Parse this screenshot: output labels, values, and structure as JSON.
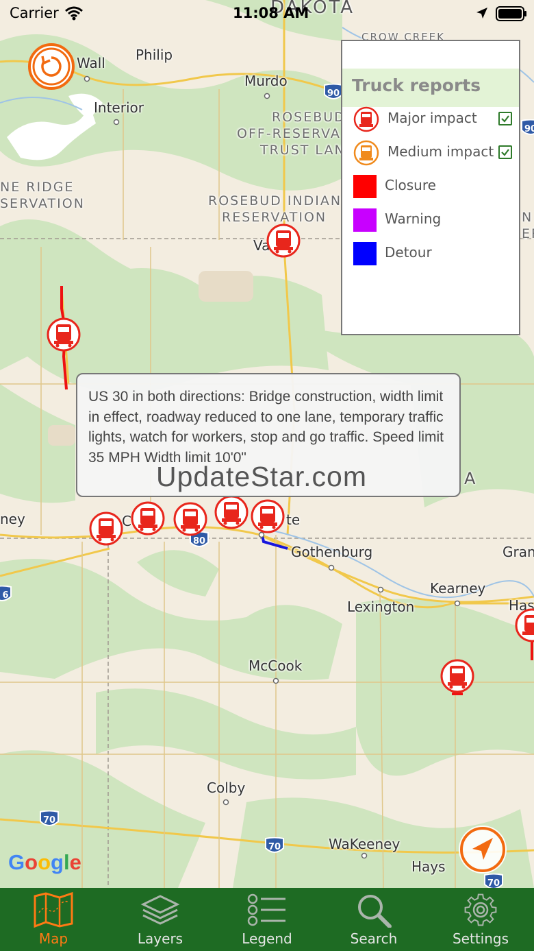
{
  "status_bar": {
    "carrier": "Carrier",
    "time": "11:08 AM"
  },
  "map": {
    "labels": {
      "dakota": "DAKOTA",
      "crow_creek": "CROW CREEK",
      "wall": "Wall",
      "philip": "Philip",
      "murdo": "Murdo",
      "interior": "Interior",
      "rosebud_off_1": "ROSEBUD",
      "rosebud_off_2": "OFF-RESERVA",
      "rosebud_off_3": "TRUST LAN",
      "pine_ridge_1": "NE RIDGE",
      "pine_ridge_2": "SERVATION",
      "rosebud_res_1": "ROSEBUD INDIAN",
      "rosebud_res_2": "RESERVATION",
      "valentine": "Va        ne",
      "ogallala_partial": "C",
      "north_platte_partial": "te",
      "kearney_left": "ney",
      "gothenburg": "Gothenburg",
      "kearney": "Kearney",
      "grand": "Gran",
      "lexington": "Lexington",
      "hastings": "Has",
      "mccook": "McCook",
      "colby": "Colby",
      "wakeeney": "WaKeeney",
      "hays": "Hays",
      "nebraska_partial": "A",
      "right_n": "N",
      "right_er": "ER"
    },
    "shields": [
      "90",
      "90",
      "80",
      "70",
      "70",
      "70",
      "6"
    ],
    "google": "Google"
  },
  "legend": {
    "title": "Truck reports",
    "items": [
      {
        "label": "Major impact",
        "checked": true,
        "color": "#e8261c",
        "kind": "truck"
      },
      {
        "label": "Medium impact",
        "checked": true,
        "color": "#f08a1c",
        "kind": "truck"
      },
      {
        "label": "Closure",
        "color": "#ff0000",
        "kind": "swatch"
      },
      {
        "label": "Warning",
        "color": "#c800ff",
        "kind": "swatch"
      },
      {
        "label": "Detour",
        "color": "#0000ff",
        "kind": "swatch"
      }
    ]
  },
  "tooltip": {
    "text": "US 30 in both directions: Bridge construction, width limit in effect, roadway reduced to one lane, temporary traffic lights, watch for workers, stop and go traffic. Speed limit 35 MPH  Width limit 10'0\""
  },
  "watermark": "UpdateStar.com",
  "tabs": [
    {
      "label": "Map",
      "icon": "map-icon",
      "active": true
    },
    {
      "label": "Layers",
      "icon": "layers-icon",
      "active": false
    },
    {
      "label": "Legend",
      "icon": "legend-list-icon",
      "active": false
    },
    {
      "label": "Search",
      "icon": "search-icon",
      "active": false
    },
    {
      "label": "Settings",
      "icon": "gear-icon",
      "active": false
    }
  ],
  "colors": {
    "accent": "#f26a10",
    "tabbar": "#1e6b23",
    "major": "#e8261c"
  }
}
